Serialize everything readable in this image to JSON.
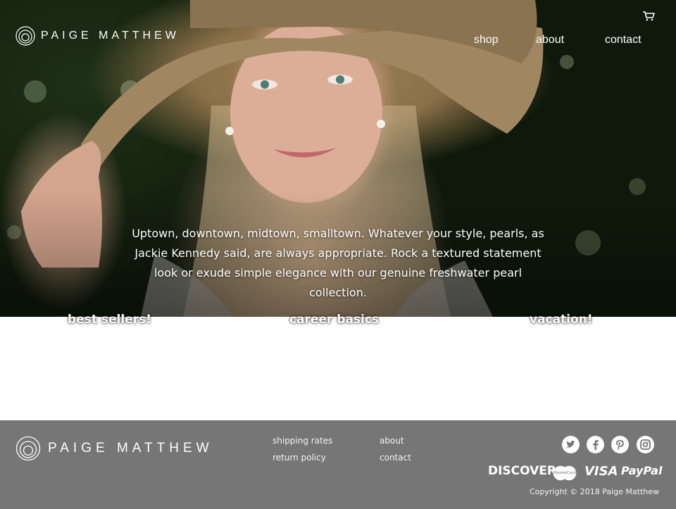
{
  "header": {
    "brand": "PAIGE MATTHEW",
    "nav": [
      {
        "label": "shop"
      },
      {
        "label": "about"
      },
      {
        "label": "contact"
      }
    ]
  },
  "hero": {
    "text": "Uptown, downtown, midtown, smalltown. Whatever your style, pearls, as Jackie Kennedy said, are always appropriate. Rock a textured statement look or exude simple elegance with our genuine freshwater pearl collection."
  },
  "collections": [
    {
      "label": "best sellers!"
    },
    {
      "label": "career basics"
    },
    {
      "label": "vacation!"
    }
  ],
  "footer": {
    "brand": "PAIGE MATTHEW",
    "links_col1": [
      {
        "label": "shipping rates"
      },
      {
        "label": "return policy"
      }
    ],
    "links_col2": [
      {
        "label": "about"
      },
      {
        "label": "contact"
      }
    ],
    "social": [
      "twitter-icon",
      "facebook-icon",
      "pinterest-icon",
      "instagram-icon"
    ],
    "payments": [
      {
        "label": "DISCOVER"
      },
      {
        "label": "MasterCard"
      },
      {
        "label": "VISA"
      },
      {
        "label": "PayPal"
      }
    ],
    "copyright": "Copyright © 2018   Paige Matthew"
  },
  "colors": {
    "footer_bg": "#767676",
    "text_light": "#ffffff"
  }
}
